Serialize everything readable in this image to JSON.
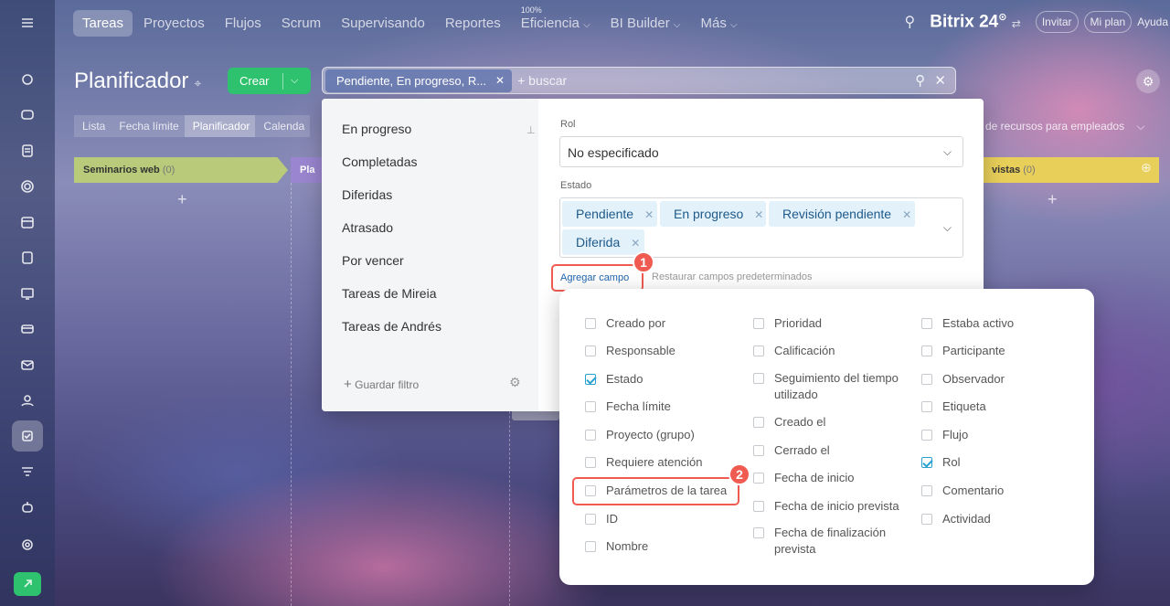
{
  "topnav": {
    "items": [
      "Tareas",
      "Proyectos",
      "Flujos",
      "Scrum",
      "Supervisando",
      "Reportes"
    ],
    "efficiency_pct": "100%",
    "efficiency": "Eficiencia",
    "bi": "BI Builder",
    "more": "Más",
    "logo": "Bitrix 24",
    "invite": "Invitar",
    "myplan": "Mi plan",
    "help": "Ayuda"
  },
  "page": {
    "title": "Planificador",
    "create": "Crear",
    "search_tag": "Pendiente, En progreso, R...",
    "search_placeholder": "+ buscar"
  },
  "views": [
    "Lista",
    "Fecha límite",
    "Planificador",
    "Calenda"
  ],
  "resources_tab": "de recursos para empleados",
  "columns": {
    "first": "Seminarios web",
    "first_count": "(0)",
    "second": "Pla",
    "last": "vistas",
    "last_count": "(0)"
  },
  "filter": {
    "presets": [
      "En progreso",
      "Completadas",
      "Diferidas",
      "Atrasado",
      "Por vencer",
      "Tareas de Mireia",
      "Tareas de Andrés"
    ],
    "save": "Guardar filtro",
    "role_label": "Rol",
    "role_value": "No especificado",
    "state_label": "Estado",
    "chips": [
      "Pendiente",
      "En progreso",
      "Revisión pendiente",
      "Diferida"
    ],
    "add_field": "Agregar campo",
    "restore": "Restaurar campos predeterminados"
  },
  "fields": {
    "col1": [
      {
        "label": "Creado por",
        "checked": false
      },
      {
        "label": "Responsable",
        "checked": false
      },
      {
        "label": "Estado",
        "checked": true
      },
      {
        "label": "Fecha límite",
        "checked": false
      },
      {
        "label": "Proyecto (grupo)",
        "checked": false
      },
      {
        "label": "Requiere atención",
        "checked": false
      },
      {
        "label": "Parámetros de la tarea",
        "checked": false
      },
      {
        "label": "ID",
        "checked": false
      },
      {
        "label": "Nombre",
        "checked": false
      }
    ],
    "col2": [
      {
        "label": "Prioridad",
        "checked": false
      },
      {
        "label": "Calificación",
        "checked": false
      },
      {
        "label": "Seguimiento del tiempo utilizado",
        "checked": false
      },
      {
        "label": "Creado el",
        "checked": false
      },
      {
        "label": "Cerrado el",
        "checked": false
      },
      {
        "label": "Fecha de inicio",
        "checked": false
      },
      {
        "label": "Fecha de inicio prevista",
        "checked": false
      },
      {
        "label": "Fecha de finalización prevista",
        "checked": false
      }
    ],
    "col3": [
      {
        "label": "Estaba activo",
        "checked": false
      },
      {
        "label": "Participante",
        "checked": false
      },
      {
        "label": "Observador",
        "checked": false
      },
      {
        "label": "Etiqueta",
        "checked": false
      },
      {
        "label": "Flujo",
        "checked": false
      },
      {
        "label": "Rol",
        "checked": true
      },
      {
        "label": "Comentario",
        "checked": false
      },
      {
        "label": "Actividad",
        "checked": false
      }
    ]
  },
  "annotations": {
    "step1": "1",
    "step2": "2"
  }
}
